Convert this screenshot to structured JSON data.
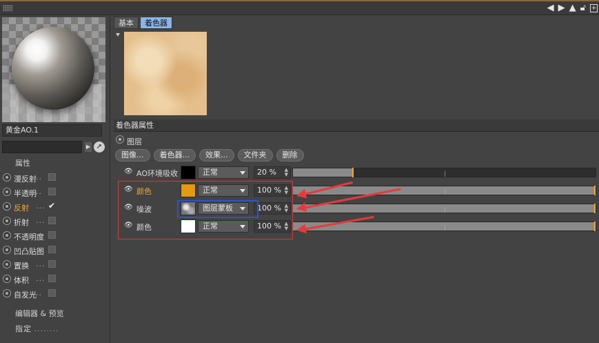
{
  "left": {
    "material_name": "黄金AO.1",
    "attributes_title": "属性",
    "channels": [
      {
        "label": "漫反射",
        "dots": "..",
        "checked": false,
        "active": false
      },
      {
        "label": "半透明",
        "dots": "..",
        "checked": false,
        "active": false
      },
      {
        "label": "反射",
        "dots": "...",
        "checked": true,
        "active": true
      },
      {
        "label": "折射",
        "dots": "...",
        "checked": false,
        "active": false
      },
      {
        "label": "不透明度",
        "dots": "",
        "checked": false,
        "active": false
      },
      {
        "label": "凹凸贴图",
        "dots": "",
        "checked": false,
        "active": false
      },
      {
        "label": "置换",
        "dots": "...",
        "checked": false,
        "active": false
      },
      {
        "label": "体积",
        "dots": "...",
        "checked": false,
        "active": false
      },
      {
        "label": "自发光",
        "dots": "..",
        "checked": false,
        "active": false
      }
    ],
    "editor_preview": "编辑器 & 预览",
    "assign_label": "指定",
    "assign_dots": "........"
  },
  "tabs": [
    {
      "label": "基本",
      "active": false
    },
    {
      "label": "着色器",
      "active": true
    }
  ],
  "section_title": "着色器属性",
  "layer_label": "图层",
  "buttons": [
    "图像...",
    "着色器...",
    "效果...",
    "文件夹",
    "删除"
  ],
  "layers": [
    {
      "name": "AO环境吸收",
      "active": false,
      "swatch": "#000000",
      "mode": "正常",
      "percent": "20 %",
      "value": 0.2
    },
    {
      "name": "颜色",
      "active": true,
      "swatch": "#e59a12",
      "mode": "正常",
      "percent": "100 %",
      "value": 1.0
    },
    {
      "name": "噪波",
      "active": false,
      "swatch": "noise",
      "mode": "图层蒙板",
      "percent": "100 %",
      "value": 1.0
    },
    {
      "name": "颜色",
      "active": false,
      "swatch": "#ffffff",
      "mode": "正常",
      "percent": "100 %",
      "value": 1.0
    }
  ],
  "icons": {
    "top": [
      "arrow-left-icon",
      "arrow-right-icon",
      "cursor-icon",
      "lock-icon",
      "new-window-icon"
    ],
    "layer": "eye-icon",
    "picker": "pick-icon"
  },
  "colors": {
    "accent": "#f3a53a",
    "tab_active": "#8ab4e6",
    "highlight_red": "#d43a3a",
    "highlight_blue": "#2c55c8"
  }
}
